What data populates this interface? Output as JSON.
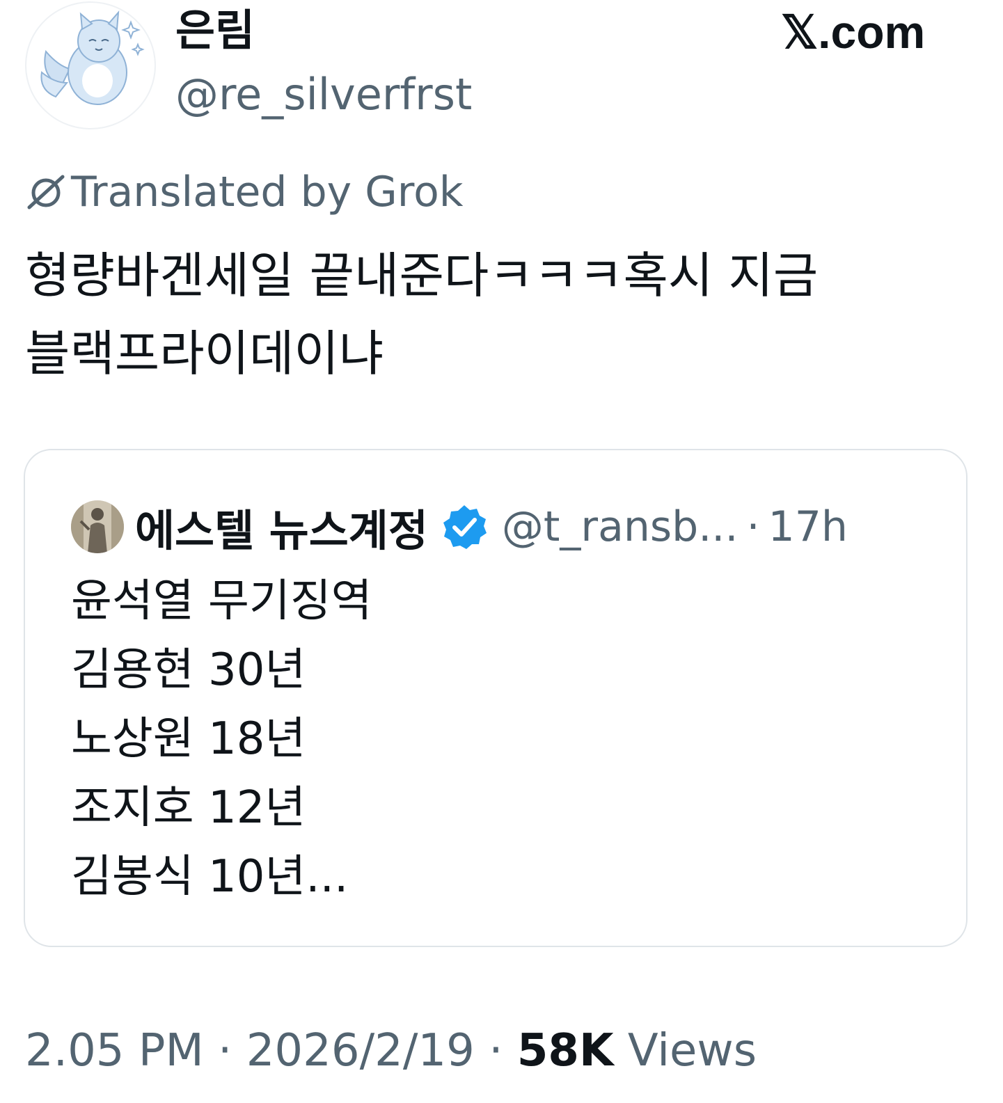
{
  "author": {
    "display_name": "은림",
    "handle": "@re_silverfrst"
  },
  "brand": "𝕏.com",
  "translation_label": "Translated by Grok",
  "tweet_text": "형량바겐세일 끝내준다ㅋㅋㅋ혹시 지금 블랙프라이데이냐",
  "quoted_tweet": {
    "display_name": "에스텔 뉴스계정",
    "handle": "@t_ransb...",
    "separator": "·",
    "time": "17h",
    "lines": [
      "윤석열 무기징역",
      "김용현 30년",
      "노상원 18년",
      "조지호 12년",
      "김봉식 10년..."
    ]
  },
  "footer": {
    "time": "2.05 PM",
    "separator": "·",
    "date": "2026/2/19",
    "views_count": "58K",
    "views_label": "Views"
  },
  "colors": {
    "text_primary": "#0f1419",
    "text_secondary": "#536471",
    "verified_blue": "#1d9bf0",
    "card_border": "#dfe4e8"
  },
  "icons": {
    "author_avatar": "fox-avatar-icon",
    "translate": "grok-icon",
    "quoted_avatar": "statue-avatar-icon",
    "verified": "verified-badge-icon"
  }
}
